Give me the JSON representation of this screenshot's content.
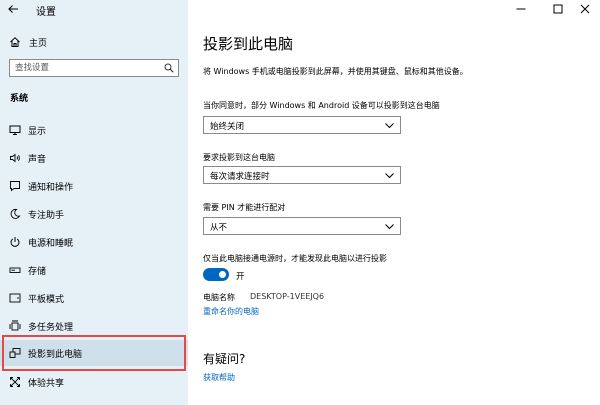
{
  "window": {
    "title": "设置"
  },
  "sidebar": {
    "home_label": "主页",
    "search_placeholder": "查找设置",
    "section_label": "系统",
    "items": [
      {
        "label": "显示",
        "icon": "monitor-icon"
      },
      {
        "label": "声音",
        "icon": "speaker-icon"
      },
      {
        "label": "通知和操作",
        "icon": "notification-icon"
      },
      {
        "label": "专注助手",
        "icon": "moon-icon"
      },
      {
        "label": "电源和睡眠",
        "icon": "power-icon"
      },
      {
        "label": "存储",
        "icon": "storage-icon"
      },
      {
        "label": "平板模式",
        "icon": "tablet-icon"
      },
      {
        "label": "多任务处理",
        "icon": "multitask-icon"
      },
      {
        "label": "投影到此电脑",
        "icon": "project-icon",
        "selected": true
      },
      {
        "label": "体验共享",
        "icon": "share-icon"
      }
    ]
  },
  "main": {
    "title": "投影到此电脑",
    "description": "将 Windows 手机或电脑投影到此屏幕，并使用其键盘、鼠标和其他设备。",
    "setting1": {
      "label": "当你同意时，部分 Windows 和 Android 设备可以投影到这台电脑",
      "value": "始终关闭"
    },
    "setting2": {
      "label": "要求投影到这台电脑",
      "value": "每次请求连接时"
    },
    "setting3": {
      "label": "需要 PIN 才能进行配对",
      "value": "从不"
    },
    "setting4": {
      "label": "仅当此电脑接通电源时，才能发现此电脑以进行投影",
      "toggle_state": "开",
      "toggle_on": true
    },
    "pc_name_label": "电脑名称",
    "pc_name_value": "DESKTOP-1VEEJQ6",
    "rename_link": "重命名你的电脑",
    "help_title": "有疑问?",
    "help_link": "获取帮助"
  },
  "colors": {
    "sidebar_bg": "#e6f1f7",
    "accent": "#0067c0",
    "highlight_border": "#e14a4a"
  }
}
